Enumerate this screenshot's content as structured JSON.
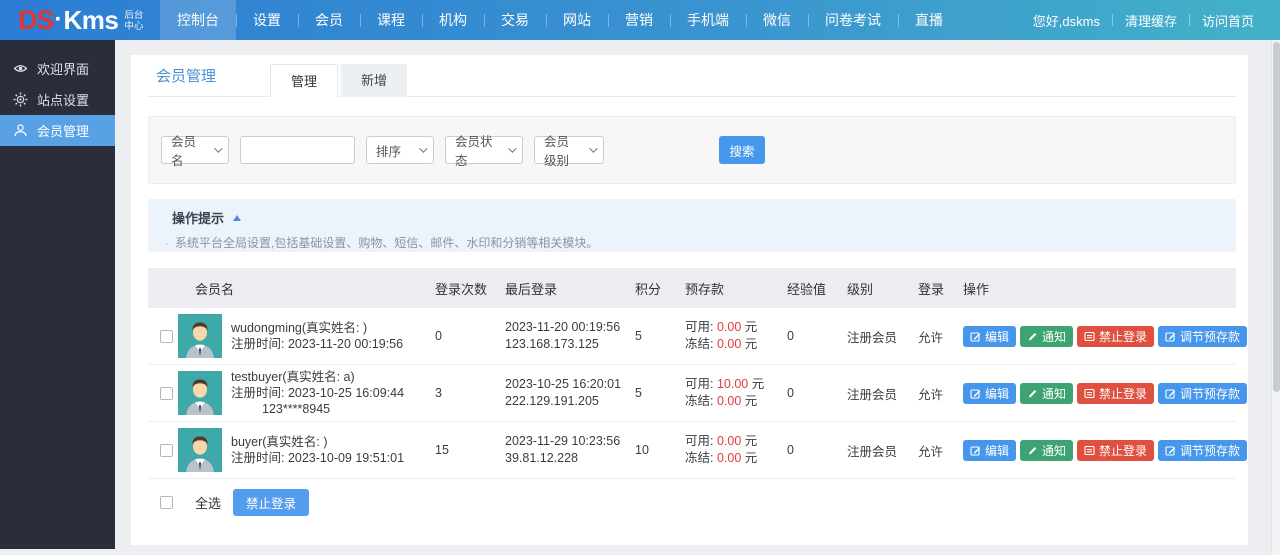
{
  "colors": {
    "nav_gradient_left": "#2c7dd2",
    "nav_gradient_right": "#43b1c8",
    "sidebar_bg": "#2a2e3c",
    "sidebar_active": "#57a1e4",
    "accent_blue": "#4697ec",
    "button_green": "#3ea372",
    "button_red": "#e0503e",
    "money_red": "#e43d3d",
    "title_blue": "#4a90d9",
    "avatar_bg": "#3fa8a8"
  },
  "topbar": {
    "logo": {
      "ds": "DS",
      "dot": "·",
      "kms": "Kms",
      "suffix_line1": "后台",
      "suffix_line2": "中心"
    },
    "menu": [
      "控制台",
      "设置",
      "会员",
      "课程",
      "机构",
      "交易",
      "网站",
      "营销",
      "手机端",
      "微信",
      "问卷考试",
      "直播"
    ],
    "active_menu": "控制台",
    "greeting": "您好,dskms",
    "clear_cache": "清理缓存",
    "visit_home": "访问首页"
  },
  "sidebar": {
    "items": [
      {
        "label": "欢迎界面",
        "icon": "eye-icon",
        "active": false
      },
      {
        "label": "站点设置",
        "icon": "gear-icon",
        "active": false
      },
      {
        "label": "会员管理",
        "icon": "user-icon",
        "active": true
      }
    ]
  },
  "page": {
    "title": "会员管理",
    "tabs": [
      {
        "label": "管理",
        "active": true
      },
      {
        "label": "新增",
        "active": false
      }
    ]
  },
  "filters": {
    "selects": [
      {
        "value": "会员名"
      },
      {
        "value": "排序"
      },
      {
        "value": "会员状态"
      },
      {
        "value": "会员级别"
      }
    ],
    "keyword_value": "",
    "search_label": "搜索"
  },
  "tips": {
    "title": "操作提示",
    "bullet": "·",
    "line": "系统平台全局设置,包括基础设置、购物、短信、邮件、水印和分销等相关模块。"
  },
  "table": {
    "headers": {
      "member": "会员名",
      "login_count": "登录次数",
      "last_login": "最后登录",
      "points": "积分",
      "deposit": "预存款",
      "exp": "经验值",
      "level": "级别",
      "login": "登录",
      "ops": "操作"
    },
    "money_labels": {
      "available": "可用:",
      "frozen": "冻结:",
      "unit": "元"
    },
    "actions": [
      {
        "label": "编辑",
        "color": "blue",
        "icon": "edit-icon"
      },
      {
        "label": "通知",
        "color": "green",
        "icon": "pencil-icon"
      },
      {
        "label": "禁止登录",
        "color": "red",
        "icon": "ban-icon"
      },
      {
        "label": "调节预存款",
        "color": "blue",
        "icon": "adjust-deposit-icon"
      }
    ],
    "rows": [
      {
        "name": "wudongming(真实姓名: )",
        "register": "注册时间: 2023-11-20 00:19:56",
        "phone": "",
        "login_count": "0",
        "last_login_time": "2023-11-20 00:19:56",
        "last_login_ip": "123.168.173.125",
        "points": "5",
        "available": "0.00",
        "frozen": "0.00",
        "exp": "0",
        "level": "注册会员",
        "login_status": "允许"
      },
      {
        "name": "testbuyer(真实姓名: a)",
        "register": "注册时间: 2023-10-25 16:09:44",
        "phone": "123****8945",
        "login_count": "3",
        "last_login_time": "2023-10-25 16:20:01",
        "last_login_ip": "222.129.191.205",
        "points": "5",
        "available": "10.00",
        "frozen": "0.00",
        "exp": "0",
        "level": "注册会员",
        "login_status": "允许"
      },
      {
        "name": "buyer(真实姓名: )",
        "register": "注册时间: 2023-10-09 19:51:01",
        "phone": "",
        "login_count": "15",
        "last_login_time": "2023-11-29 10:23:56",
        "last_login_ip": "39.81.12.228",
        "points": "10",
        "available": "0.00",
        "frozen": "0.00",
        "exp": "0",
        "level": "注册会员",
        "login_status": "允许"
      }
    ],
    "select_all_label": "全选",
    "bulk_button_label": "禁止登录"
  }
}
